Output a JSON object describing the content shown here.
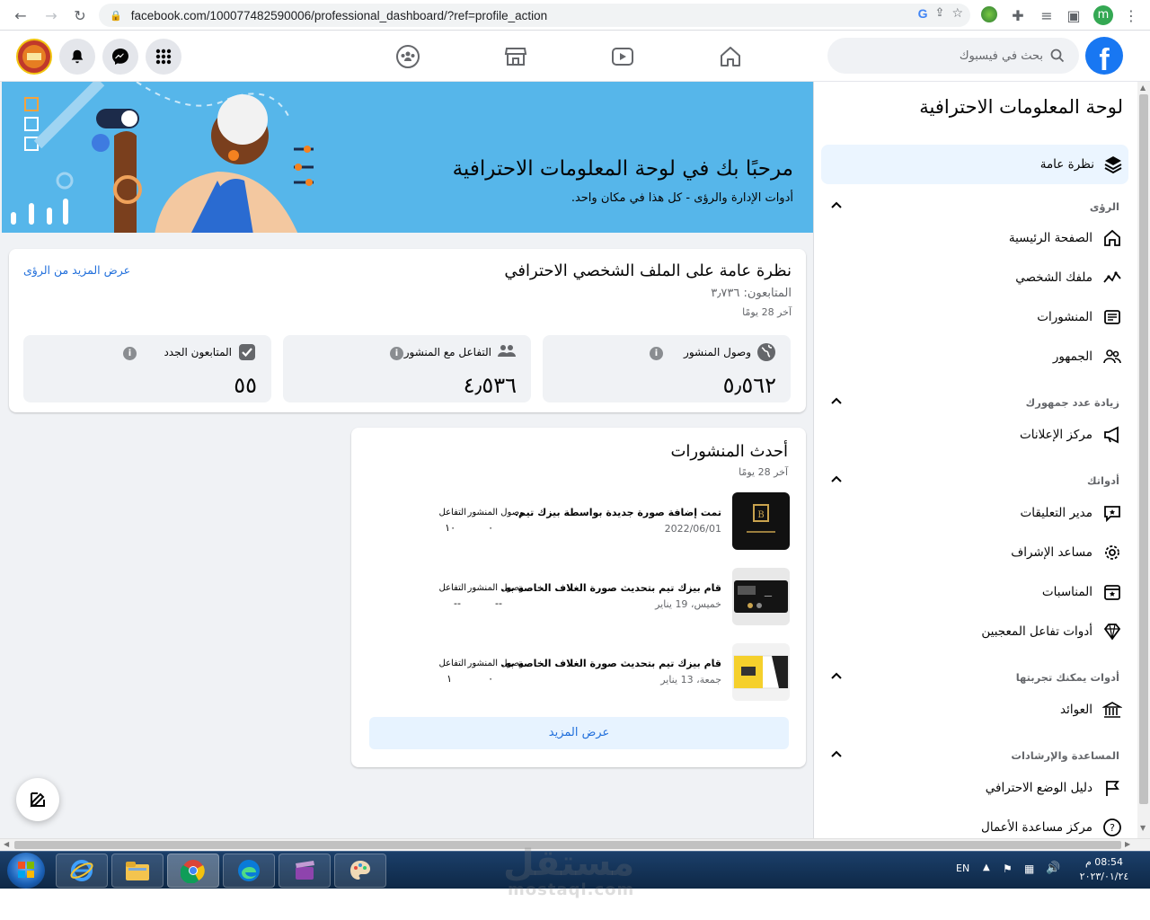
{
  "browser": {
    "url": "facebook.com/100077482590006/professional_dashboard/?ref=profile_action",
    "profile_initial": "m"
  },
  "header": {
    "search_placeholder": "بحث في فيسبوك",
    "logo_letter": "f"
  },
  "banner": {
    "title": "مرحبًا بك في لوحة المعلومات الاحترافية",
    "subtitle": "أدوات الإدارة والرؤى - كل هذا في مكان واحد."
  },
  "overview": {
    "title": "نظرة عامة على الملف الشخصي الاحترافي",
    "followers": "المتابعون: ٣٫٧٣٦",
    "period": "آخر 28 يومًا",
    "more_link": "عرض المزيد من الرؤى",
    "stats": [
      {
        "label": "وصول المنشور",
        "value": "٥٫٥٦٢"
      },
      {
        "label": "التفاعل مع المنشور",
        "value": "٤٫٥٣٦"
      },
      {
        "label": "المتابعون الجدد",
        "value": "٥٥"
      }
    ]
  },
  "recent": {
    "title": "أحدث المنشورات",
    "period": "آخر 28 يومًا",
    "reach_header": "وصول المنشور",
    "engagement_header": "التفاعل",
    "more_button": "عرض المزيد",
    "posts": [
      {
        "title": "تمت إضافة صورة جديدة بواسطة بيزك تيم.",
        "date": "2022/06/01",
        "reach": "٠",
        "engagement": "١٠"
      },
      {
        "title": "قام بيزك تيم بتحديث صورة الغلاف الخاصة به.",
        "date": "خميس، 19 يناير",
        "reach": "--",
        "engagement": "--"
      },
      {
        "title": "قام بيزك تيم بتحديث صورة الغلاف الخاصة به.",
        "date": "جمعة، 13 يناير",
        "reach": "٠",
        "engagement": "١"
      }
    ]
  },
  "sidebar": {
    "title": "لوحة المعلومات الاحترافية",
    "overview_item": "نظرة عامة",
    "sections": [
      {
        "heading": "الرؤى",
        "items": [
          "الصفحة الرئيسية",
          "ملفك الشخصي",
          "المنشورات",
          "الجمهور"
        ]
      },
      {
        "heading": "زيادة عدد جمهورك",
        "items": [
          "مركز الإعلانات"
        ]
      },
      {
        "heading": "أدواتك",
        "items": [
          "مدير التعليقات",
          "مساعد الإشراف",
          "المناسبات",
          "أدوات تفاعل المعجبين"
        ]
      },
      {
        "heading": "أدوات يمكنك تجربتها",
        "items": [
          "العوائد"
        ]
      },
      {
        "heading": "المساعدة والإرشادات",
        "items": [
          "دليل الوضع الاحترافي",
          "مركز مساعدة الأعمال"
        ]
      }
    ]
  },
  "taskbar": {
    "lang": "EN",
    "time": "08:54 م",
    "date": "٢٠٢٣/٠١/٢٤"
  },
  "watermark": {
    "text": "مستقل",
    "domain": "mostaql.com"
  },
  "colors": {
    "fb_blue": "#1877f2",
    "banner": "#56b6ea",
    "link": "#216fdb"
  }
}
